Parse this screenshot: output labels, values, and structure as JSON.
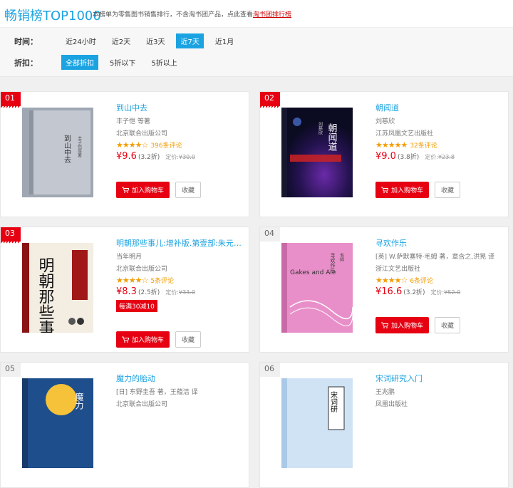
{
  "header": {
    "title": "畅销榜TOP1000",
    "desc_text": "本榜单为零售图书销售排行，不含淘书团产品，点此查看",
    "desc_link": "淘书团排行榜"
  },
  "filters": {
    "time_label": "时间：",
    "time_options": [
      "近24小时",
      "近2天",
      "近3天",
      "近7天",
      "近1月"
    ],
    "discount_label": "折扣：",
    "discount_options": [
      "全部折扣",
      "5折以下",
      "5折以上"
    ]
  },
  "buttons": {
    "cart": "加入购物车",
    "fav": "收藏"
  },
  "books": [
    {
      "rank": "01",
      "title": "到山中去",
      "author": "丰子恺 等著",
      "publisher": "北京联合出版公司",
      "stars": "★★★★☆",
      "reviews": "396条评论",
      "price": "¥9.6",
      "discount": "(3.2折)",
      "original_label": "定价:",
      "original": "¥30.0",
      "promo": ""
    },
    {
      "rank": "02",
      "title": "朝闻道",
      "author": "刘慈欣",
      "publisher": "江苏凤凰文艺出版社",
      "stars": "★★★★★",
      "reviews": "32条评论",
      "price": "¥9.0",
      "discount": "(3.8折)",
      "original_label": "定价:",
      "original": "¥23.8",
      "promo": ""
    },
    {
      "rank": "03",
      "title": "明朝那些事儿:增补版.第壹部:朱元璋:从",
      "author": "当年明月",
      "publisher": "北京联合出版公司",
      "stars": "★★★★☆",
      "reviews": "5条评论",
      "price": "¥8.3",
      "discount": "(2.5折)",
      "original_label": "定价:",
      "original": "¥33.0",
      "promo": "每满30减10"
    },
    {
      "rank": "04",
      "title": "寻欢作乐",
      "author": "[英] W.萨默塞特·毛姆 著，章含之,洪晃 译",
      "publisher": "浙江文艺出版社",
      "stars": "★★★★☆",
      "reviews": "6条评论",
      "price": "¥16.6",
      "discount": "(3.2折)",
      "original_label": "定价:",
      "original": "¥52.0",
      "promo": ""
    },
    {
      "rank": "05",
      "title": "魔力的胎动",
      "author": "[日] 东野圭吾 著，王蕴洁 译",
      "publisher": "北京联合出版公司",
      "stars": "",
      "reviews": "",
      "price": "",
      "discount": "",
      "original_label": "",
      "original": "",
      "promo": ""
    },
    {
      "rank": "06",
      "title": "宋词研究入门",
      "author": "王兆鹏",
      "publisher": "凤凰出版社",
      "stars": "",
      "reviews": "",
      "price": "",
      "discount": "",
      "original_label": "",
      "original": "",
      "promo": ""
    }
  ],
  "covers": {
    "c1": {
      "v1": "到山中去",
      "v2": "丰子恺等著"
    },
    "c2": {
      "v1": "朝闻道",
      "v2": "刘慈欣"
    },
    "c3": {
      "v1": "明朝那些事儿"
    },
    "c4": {
      "v1": "Gakes and Ale",
      "v2": "寻欢作乐",
      "v3": "毛姆"
    },
    "c5": {
      "v1": "魔力"
    },
    "c6": {
      "v1": "宋词研"
    }
  },
  "colors": {
    "accent": "#1ba3e1",
    "red": "#e60012",
    "star": "#f29d04"
  }
}
